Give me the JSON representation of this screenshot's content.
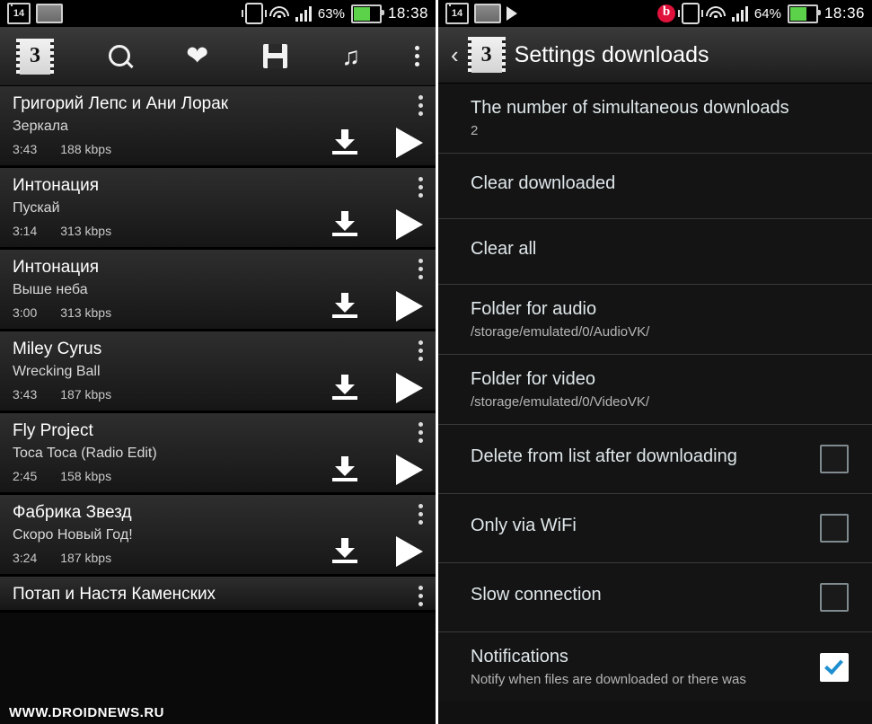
{
  "left": {
    "status": {
      "icons": [
        "notification-14-icon",
        "sd-card-icon"
      ],
      "right_icons": [
        "vibrate-icon",
        "wifi-icon",
        "signal-icon"
      ],
      "battery": "63%",
      "clock": "18:38"
    },
    "toolbar": {
      "logo": "app-logo",
      "items": [
        "search-icon",
        "heart-icon",
        "save-icon",
        "music-note-icon",
        "overflow-menu-icon"
      ]
    },
    "tracks": [
      {
        "title": "Григорий Лепс и Ани Лорак",
        "song": "Зеркала",
        "duration": "3:43",
        "bitrate": "188 kbps"
      },
      {
        "title": "Интонация",
        "song": "Пускай",
        "duration": "3:14",
        "bitrate": "313 kbps"
      },
      {
        "title": "Интонация",
        "song": "Выше неба",
        "duration": "3:00",
        "bitrate": "313 kbps"
      },
      {
        "title": "Miley Cyrus",
        "song": "Wrecking Ball",
        "duration": "3:43",
        "bitrate": "187 kbps"
      },
      {
        "title": "Fly Project",
        "song": "Toca Toca (Radio Edit)",
        "duration": "2:45",
        "bitrate": "158 kbps"
      },
      {
        "title": "Фабрика Звезд",
        "song": "Скоро Новый Год!",
        "duration": "3:24",
        "bitrate": "187 kbps"
      },
      {
        "title": "Потап и Настя Каменских",
        "song": "",
        "duration": "",
        "bitrate": ""
      }
    ],
    "watermark": "WWW.DROIDNEWS.RU"
  },
  "right": {
    "status": {
      "icons": [
        "notification-14-icon",
        "sd-card-icon",
        "play-icon"
      ],
      "right_icons": [
        "beats-audio-icon",
        "vibrate-icon",
        "wifi-icon",
        "signal-icon"
      ],
      "battery": "64%",
      "clock": "18:36"
    },
    "header": {
      "back": "‹",
      "title": "Settings downloads"
    },
    "settings": [
      {
        "label": "The number of simultaneous downloads",
        "value": "2",
        "control": "none"
      },
      {
        "label": "Clear downloaded",
        "value": "",
        "control": "none"
      },
      {
        "label": "Clear all",
        "value": "",
        "control": "none"
      },
      {
        "label": "Folder for audio",
        "value": "/storage/emulated/0/AudioVK/",
        "control": "none"
      },
      {
        "label": "Folder for video",
        "value": "/storage/emulated/0/VideoVK/",
        "control": "none"
      },
      {
        "label": "Delete from list after downloading",
        "value": "",
        "control": "checkbox",
        "checked": false
      },
      {
        "label": "Only via WiFi",
        "value": "",
        "control": "checkbox",
        "checked": false
      },
      {
        "label": "Slow connection",
        "value": "",
        "control": "checkbox",
        "checked": false
      },
      {
        "label": "Notifications",
        "value": "Notify when files are downloaded or there was",
        "control": "checkbox",
        "checked": true
      }
    ]
  },
  "colors": {
    "accent_red": "#e0123c",
    "battery_green": "#5bd24a",
    "check_blue": "#1d8ecf"
  }
}
